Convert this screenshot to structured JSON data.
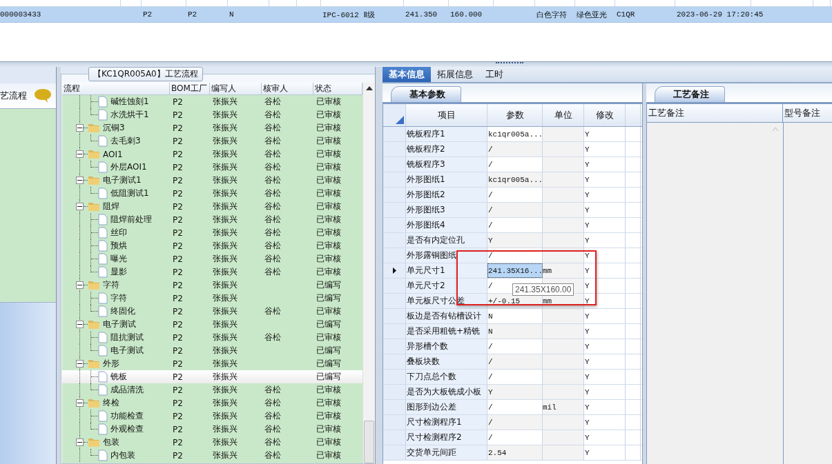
{
  "record_grid": {
    "selected_row": {
      "column_1": "000003433",
      "column_3": "P2",
      "column_4": "P2",
      "column_5": "N",
      "column_8": "IPC-6012 Ⅱ级",
      "column_9": "241.350",
      "column_10": "160.000",
      "column_12": "白色字符",
      "column_13": "绿色亚光",
      "column_14": "C1QR",
      "column_15": "2023-06-29 17:20:45"
    }
  },
  "sidebar": {
    "title": "艺流程"
  },
  "process_flow": {
    "title": "【KC1QR005A0】工艺流程",
    "columns": [
      "流程",
      "BOM工厂",
      "编写人",
      "核审人",
      "状态"
    ],
    "rows": [
      {
        "kind": "step",
        "name": "碱性蚀刻1",
        "factory": "P2",
        "writer": "张振兴",
        "reviewer": "谷松",
        "status": "已审核",
        "selected": false
      },
      {
        "kind": "step",
        "name": "水洗烘干1",
        "factory": "P2",
        "writer": "张振兴",
        "reviewer": "谷松",
        "status": "已审核",
        "selected": false
      },
      {
        "kind": "group",
        "name": "沉铜3",
        "factory": "P2",
        "writer": "张振兴",
        "reviewer": "谷松",
        "status": "已审核",
        "selected": false,
        "expanded": true,
        "children": [
          {
            "kind": "step",
            "name": "去毛刺3",
            "factory": "P2",
            "writer": "张振兴",
            "reviewer": "谷松",
            "status": "已审核",
            "selected": false
          }
        ]
      },
      {
        "kind": "group",
        "name": "AOI1",
        "factory": "P2",
        "writer": "张振兴",
        "reviewer": "谷松",
        "status": "已审核",
        "selected": false,
        "expanded": true,
        "children": [
          {
            "kind": "step",
            "name": "外层AOI1",
            "factory": "P2",
            "writer": "张振兴",
            "reviewer": "谷松",
            "status": "已审核",
            "selected": false
          }
        ]
      },
      {
        "kind": "group",
        "name": "电子测试1",
        "factory": "P2",
        "writer": "张振兴",
        "reviewer": "谷松",
        "status": "已审核",
        "selected": false,
        "expanded": true,
        "children": [
          {
            "kind": "step",
            "name": "低阻测试1",
            "factory": "P2",
            "writer": "张振兴",
            "reviewer": "谷松",
            "status": "已审核",
            "selected": false
          }
        ]
      },
      {
        "kind": "group",
        "name": "阻焊",
        "factory": "P2",
        "writer": "张振兴",
        "reviewer": "谷松",
        "status": "已审核",
        "selected": false,
        "expanded": true,
        "children": [
          {
            "kind": "step",
            "name": "阻焊前处理",
            "factory": "P2",
            "writer": "张振兴",
            "reviewer": "谷松",
            "status": "已审核",
            "selected": false
          },
          {
            "kind": "step",
            "name": "丝印",
            "factory": "P2",
            "writer": "张振兴",
            "reviewer": "谷松",
            "status": "已审核",
            "selected": false
          },
          {
            "kind": "step",
            "name": "预烘",
            "factory": "P2",
            "writer": "张振兴",
            "reviewer": "谷松",
            "status": "已审核",
            "selected": false
          },
          {
            "kind": "step",
            "name": "曝光",
            "factory": "P2",
            "writer": "张振兴",
            "reviewer": "谷松",
            "status": "已审核",
            "selected": false
          },
          {
            "kind": "step",
            "name": "显影",
            "factory": "P2",
            "writer": "张振兴",
            "reviewer": "谷松",
            "status": "已审核",
            "selected": false
          }
        ]
      },
      {
        "kind": "group",
        "name": "字符",
        "factory": "P2",
        "writer": "张振兴",
        "status": "已编写",
        "selected": false,
        "expanded": true,
        "children": [
          {
            "kind": "step",
            "name": "字符",
            "factory": "P2",
            "writer": "张振兴",
            "status": "已编写",
            "selected": false
          },
          {
            "kind": "step",
            "name": "终固化",
            "factory": "P2",
            "writer": "张振兴",
            "reviewer": "谷松",
            "status": "已审核",
            "selected": false
          }
        ]
      },
      {
        "kind": "group",
        "name": "电子测试",
        "factory": "P2",
        "writer": "张振兴",
        "status": "已编写",
        "selected": false,
        "expanded": true,
        "children": [
          {
            "kind": "step",
            "name": "阻抗测试",
            "factory": "P2",
            "writer": "张振兴",
            "reviewer": "谷松",
            "status": "已审核",
            "selected": false
          },
          {
            "kind": "step",
            "name": "电子测试",
            "factory": "P2",
            "writer": "张振兴",
            "status": "已编写",
            "selected": false
          }
        ]
      },
      {
        "kind": "group",
        "name": "外形",
        "factory": "P2",
        "writer": "张振兴",
        "status": "已编写",
        "selected": false,
        "expanded": true,
        "children": [
          {
            "kind": "step",
            "name": "铣板",
            "factory": "P2",
            "writer": "张振兴",
            "status": "已编写",
            "selected": true
          },
          {
            "kind": "step",
            "name": "成品清洗",
            "factory": "P2",
            "writer": "张振兴",
            "reviewer": "谷松",
            "status": "已审核",
            "selected": false
          }
        ]
      },
      {
        "kind": "group",
        "name": "终检",
        "factory": "P2",
        "writer": "张振兴",
        "reviewer": "谷松",
        "status": "已审核",
        "selected": false,
        "expanded": true,
        "children": [
          {
            "kind": "step",
            "name": "功能检查",
            "factory": "P2",
            "writer": "张振兴",
            "reviewer": "谷松",
            "status": "已审核",
            "selected": false
          },
          {
            "kind": "step",
            "name": "外观检查",
            "factory": "P2",
            "writer": "张振兴",
            "reviewer": "谷松",
            "status": "已审核",
            "selected": false
          }
        ]
      },
      {
        "kind": "group",
        "name": "包装",
        "factory": "P2",
        "writer": "张振兴",
        "reviewer": "谷松",
        "status": "已审核",
        "selected": false,
        "expanded": true,
        "children": [
          {
            "kind": "step",
            "name": "内包装",
            "factory": "P2",
            "writer": "张振兴",
            "reviewer": "谷松",
            "status": "已审核",
            "selected": false
          }
        ]
      }
    ]
  },
  "tabs": [
    {
      "label": "基本信息",
      "selected": true
    },
    {
      "label": "拓展信息",
      "selected": false
    },
    {
      "label": "工时",
      "selected": false
    }
  ],
  "basic_params": {
    "tab": "基本参数",
    "columns": [
      "项目",
      "参数",
      "单位",
      "修改"
    ],
    "rows": [
      {
        "item": "铣板程序1",
        "value": "kc1qr005a...",
        "modify": "Y",
        "current": false
      },
      {
        "item": "铣板程序2",
        "value": "/",
        "modify": "Y",
        "current": false
      },
      {
        "item": "铣板程序3",
        "value": "/",
        "modify": "Y",
        "current": false
      },
      {
        "item": "外形图纸1",
        "value": "kc1qr005a...",
        "modify": "Y",
        "current": false
      },
      {
        "item": "外形图纸2",
        "value": "/",
        "modify": "Y",
        "current": false
      },
      {
        "item": "外形图纸3",
        "value": "/",
        "modify": "Y",
        "current": false
      },
      {
        "item": "外形图纸4",
        "value": "/",
        "modify": "Y",
        "current": false
      },
      {
        "item": "是否有内定位孔",
        "value": "Y",
        "modify": "Y",
        "current": false
      },
      {
        "item": "外形露铜图纸",
        "value": "/",
        "modify": "Y",
        "current": false
      },
      {
        "item": "单元尺寸1",
        "value": "241.35X16...",
        "unit": "mm",
        "modify": "Y",
        "current": true
      },
      {
        "item": "单元尺寸2",
        "value": "/",
        "modify": "Y",
        "current": false
      },
      {
        "item": "单元板尺寸公差",
        "value": "+/-0.15",
        "unit": "mm",
        "modify": "Y",
        "current": false
      },
      {
        "item": "板边是否有钻槽设计",
        "value": "N",
        "modify": "Y",
        "current": false
      },
      {
        "item": "是否采用粗铣+精铣",
        "value": "N",
        "modify": "Y",
        "current": false
      },
      {
        "item": "异形槽个数",
        "value": "/",
        "modify": "Y",
        "current": false
      },
      {
        "item": "叠板块数",
        "value": "/",
        "modify": "Y",
        "current": false
      },
      {
        "item": "下刀点总个数",
        "value": "/",
        "modify": "Y",
        "current": false
      },
      {
        "item": "是否为大板铣成小板",
        "value": "Y",
        "modify": "Y",
        "current": false
      },
      {
        "item": "图形到边公差",
        "value": "/",
        "unit": "mil",
        "modify": "Y",
        "current": false
      },
      {
        "item": "尺寸检测程序1",
        "value": "/",
        "modify": "Y",
        "current": false
      },
      {
        "item": "尺寸检测程序2",
        "value": "/",
        "modify": "Y",
        "current": false
      },
      {
        "item": "交货单元间距",
        "value": "2.54",
        "modify": "Y",
        "current": false
      }
    ],
    "tooltip": "241.35X160.00"
  },
  "remarks": {
    "tab": "工艺备注",
    "columns": [
      "工艺备注",
      "型号备注"
    ]
  }
}
